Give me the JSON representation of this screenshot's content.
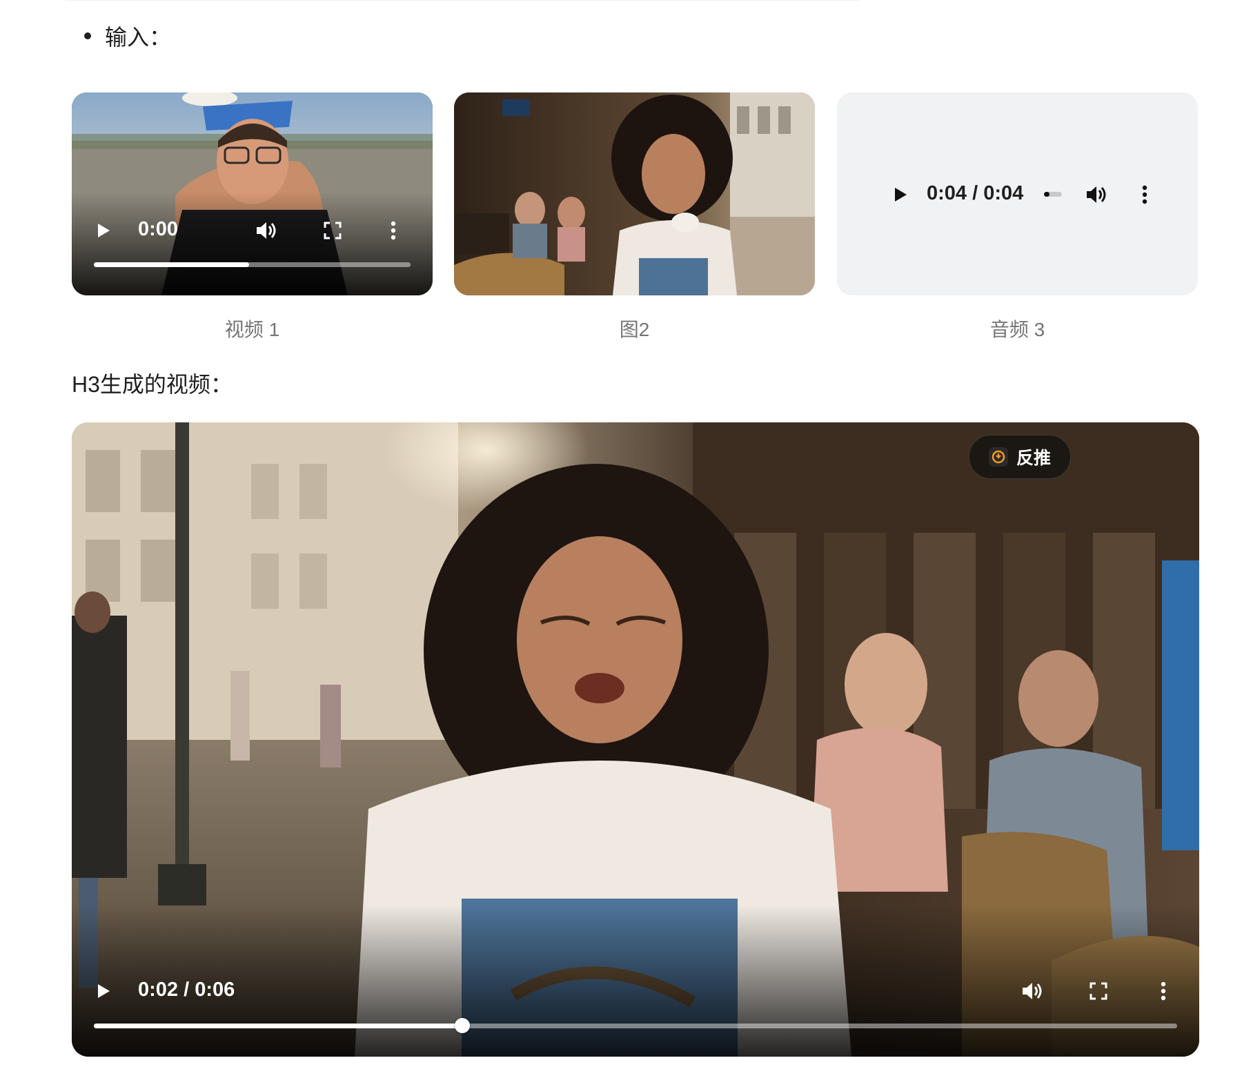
{
  "input_section": {
    "label": "输入："
  },
  "tiles": [
    {
      "type": "video",
      "caption": "视频 1",
      "time": "0:00",
      "progress": 0.49,
      "icons": [
        "play-icon",
        "volume-icon",
        "fullscreen-icon",
        "more-options-icon"
      ]
    },
    {
      "type": "image",
      "caption": "图2"
    },
    {
      "type": "audio",
      "caption": "音频 3",
      "time": "0:04 / 0:04",
      "volume_level": 0.3,
      "icons": [
        "play-icon",
        "volume-icon",
        "more-options-icon"
      ]
    }
  ],
  "output_section": {
    "label": "H3生成的视频："
  },
  "main_video": {
    "time": "0:02 / 0:06",
    "progress": 0.34,
    "badge": {
      "icon": "reverse-prompt-icon",
      "label": "反推"
    },
    "icons": [
      "play-icon",
      "volume-icon",
      "fullscreen-icon",
      "more-options-icon"
    ]
  },
  "colors": {
    "accent_orange": "#f59a23",
    "control_white": "#ffffff",
    "audio_bg": "#f1f2f4"
  }
}
